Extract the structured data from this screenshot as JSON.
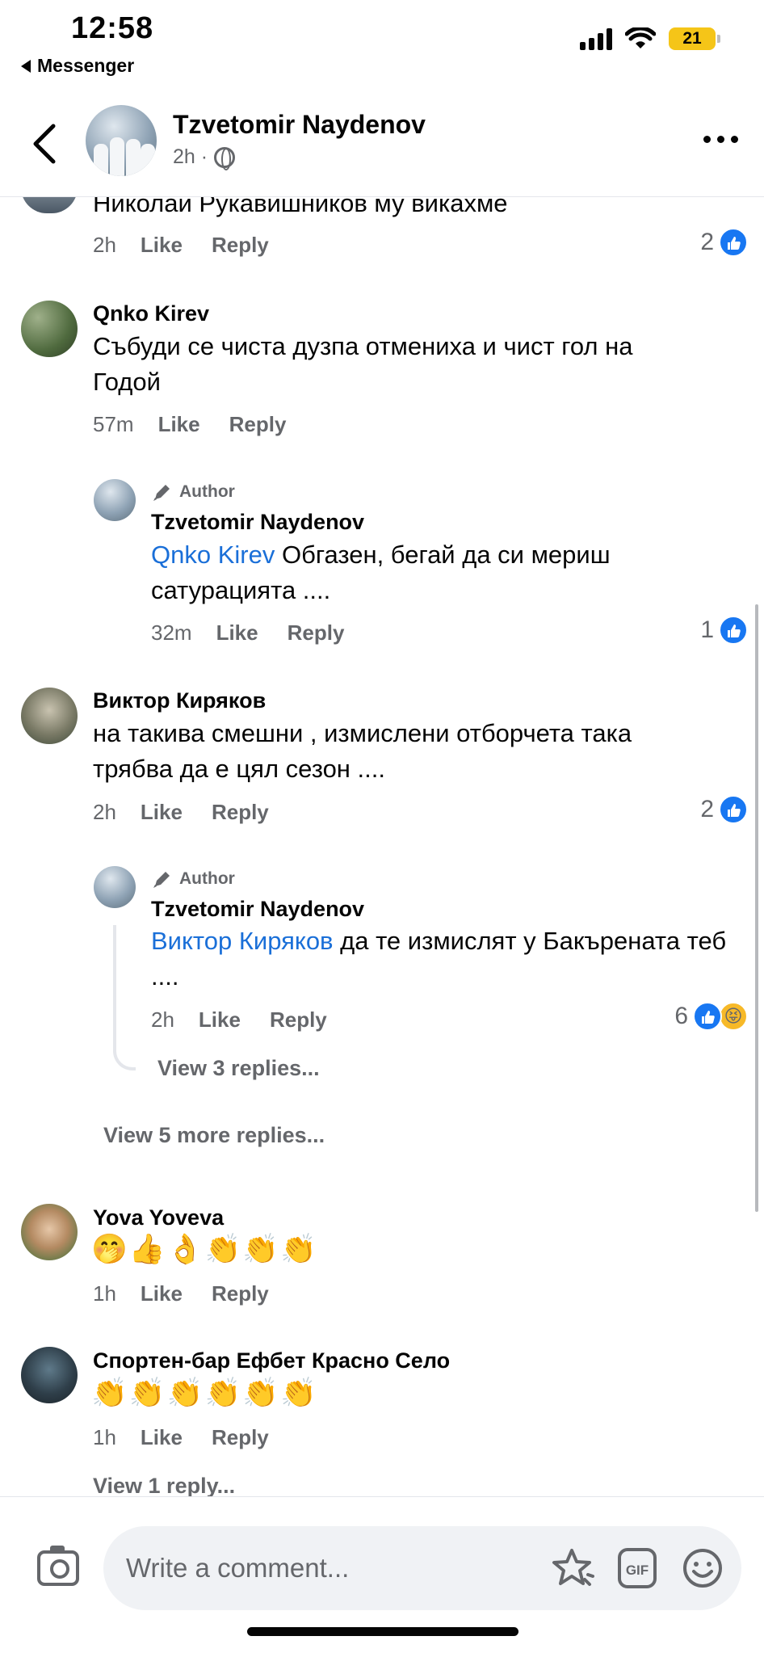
{
  "status_bar": {
    "time": "12:58",
    "back_app": "Messenger",
    "battery": "21"
  },
  "header": {
    "name": "Tzvetomir Naydenov",
    "meta": "2h ·"
  },
  "comments": [
    {
      "name": "",
      "text": "Николаи Рукавишников му викахме",
      "time": "2h",
      "like": "Like",
      "reply": "Reply",
      "reactions": "2"
    },
    {
      "name": "Qnko Kirev",
      "text": "Събуди се чиста дузпа отмениха и чист гол на Годой",
      "time": "57m",
      "like": "Like",
      "reply": "Reply"
    },
    {
      "author_tag": "Author",
      "name": "Tzvetomir Naydenov",
      "mention": "Qnko Kirev",
      "text": " Обгазен, бегай да  си мериш сатурацията ....",
      "time": "32m",
      "like": "Like",
      "reply": "Reply",
      "reactions": "1"
    },
    {
      "name": "Виктор Киряков",
      "text": "на такива смешни , измислени отборчета така трябва да е цял сезон ....",
      "time": "2h",
      "like": "Like",
      "reply": "Reply",
      "reactions": "2"
    },
    {
      "author_tag": "Author",
      "name": "Tzvetomir Naydenov",
      "mention": "Виктор Киряков",
      "text": " да те измислят у Бакърената теб ....",
      "time": "2h",
      "like": "Like",
      "reply": "Reply",
      "reactions": "6"
    },
    {
      "name": "Yova Yoveva",
      "text": "🤭👍👌👏👏👏",
      "time": "1h",
      "like": "Like",
      "reply": "Reply"
    },
    {
      "name": "Спортен-бар Ефбет Красно Село",
      "text": "👏👏👏👏👏👏",
      "time": "1h",
      "like": "Like",
      "reply": "Reply"
    }
  ],
  "links": {
    "view_3_replies": "View 3 replies...",
    "view_5_more": "View 5 more replies...",
    "view_1_reply": "View 1 reply..."
  },
  "composer": {
    "placeholder": "Write a comment..."
  },
  "icons": [
    "back-chevron-icon",
    "globe-icon",
    "more-icon",
    "like-icon",
    "haha-icon",
    "pen-icon",
    "camera-icon",
    "sticker-icon",
    "gif-icon",
    "emoji-icon"
  ],
  "colors": {
    "link": "#1a6fd8",
    "like_blue": "#1877f2",
    "muted": "#65676b",
    "battery": "#f5c518"
  }
}
